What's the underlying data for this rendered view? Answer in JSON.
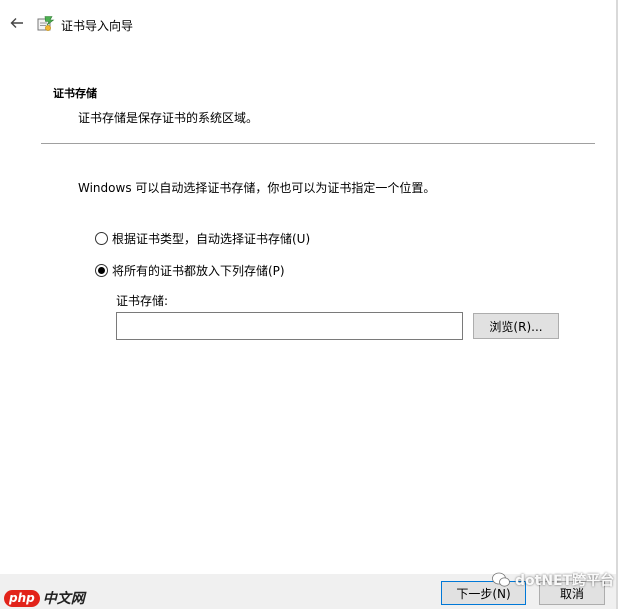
{
  "window": {
    "title": "证书导入向导"
  },
  "header": {
    "section_title": "证书存储",
    "section_desc": "证书存储是保存证书的系统区域。"
  },
  "body": {
    "intro": "Windows 可以自动选择证书存储，你也可以为证书指定一个位置。",
    "options": [
      {
        "label": "根据证书类型，自动选择证书存储(U)",
        "selected": false
      },
      {
        "label": "将所有的证书都放入下列存储(P)",
        "selected": true
      }
    ],
    "store": {
      "label": "证书存储:",
      "value": "",
      "browse_label": "浏览(R)..."
    }
  },
  "footer": {
    "next_label": "下一步(N)",
    "cancel_label": "取消"
  },
  "watermarks": {
    "wechat_text": "dotNET跨平台",
    "php_badge": "php",
    "php_text": "中文网"
  },
  "colors": {
    "accent": "#0078d7",
    "divider": "#a0a0a0",
    "button_bg": "#e1e1e1",
    "footer_bg": "#f0f0f0"
  },
  "icons": {
    "back": "arrow-left-icon",
    "wizard": "certificate-icon"
  }
}
